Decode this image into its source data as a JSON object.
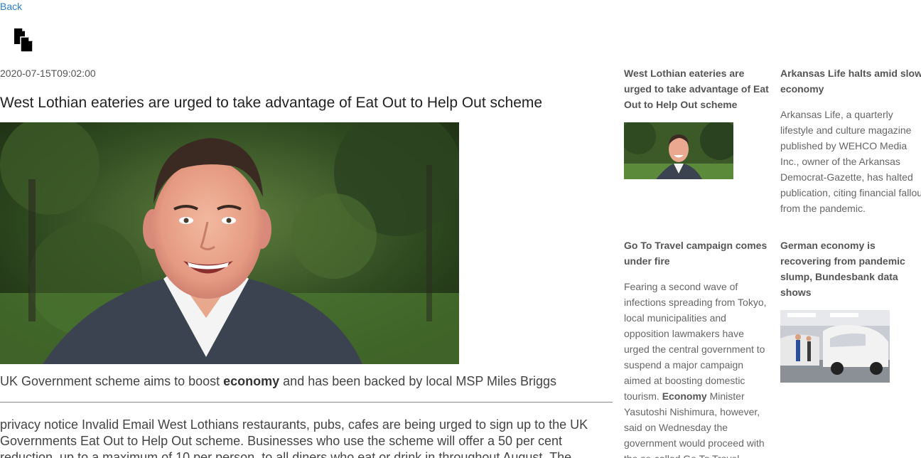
{
  "nav": {
    "back_label": "Back"
  },
  "icons": {
    "copy": "copy-icon"
  },
  "article": {
    "date": "2020-07-15T09:02:00",
    "title": "West Lothian eateries are urged to take advantage of Eat Out to Help Out scheme",
    "subhead_before": "UK Government scheme aims to boost ",
    "subhead_bold": "economy",
    "subhead_after": " and has been backed by local MSP Miles Briggs",
    "body": "privacy notice Invalid Email West Lothians restaurants, pubs, cafes are being urged to sign up to the UK Governments Eat Out to Help Out scheme. Businesses who use the scheme will offer a 50 per cent reduction, up to a maximum of 10 per person, to all diners who eat or drink in throughout August. The"
  },
  "sidebar": {
    "cards": [
      {
        "title": "West Lothian eateries are urged to take advantage of Eat Out to Help Out scheme"
      },
      {
        "title": "Arkansas Life halts amid slow economy",
        "text": "Arkansas Life, a quarterly lifestyle and culture magazine published by WEHCO Media Inc., owner of the Arkansas Democrat-Gazette, has halted publication, citing financial fallout from the pandemic."
      },
      {
        "title": "Go To Travel campaign comes under fire",
        "text_before": "Fearing a second wave of infections spreading from Tokyo, local municipalities and opposition lawmakers have urged the central government to suspend a major campaign aimed at boosting domestic tourism. ",
        "text_bold": "Economy",
        "text_after": " Minister Yasutoshi Nishimura, however, said on Wednesday the government would proceed with the so-called Go To Travel"
      },
      {
        "title": "German economy is recovering from pandemic slump, Bundesbank data shows"
      }
    ]
  },
  "colors": {
    "link": "#2a7fc7",
    "divider": "#888888"
  }
}
